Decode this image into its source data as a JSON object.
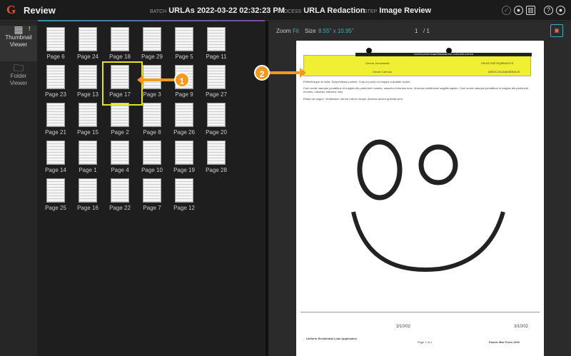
{
  "header": {
    "logo": "G",
    "title": "Review",
    "batch_label": "BATCH",
    "batch": "URLAs 2022-03-22 02:32:23 PM",
    "process_label": "PROCESS",
    "process": "URLA Redaction",
    "step_label": "STEP",
    "step": "Image Review"
  },
  "sidebar": {
    "items": [
      {
        "label": "Thumbnail Viewer",
        "badge": "!"
      },
      {
        "label": "Folder Viewer"
      }
    ]
  },
  "thumbnails": [
    "Page 6",
    "Page 24",
    "Page 18",
    "Page 29",
    "Page 5",
    "Page 11",
    "Page 23",
    "Page 13",
    "Page 17",
    "Page 3",
    "Page 9",
    "Page 27",
    "Page 21",
    "Page 15",
    "Page 2",
    "Page 8",
    "Page 26",
    "Page 20",
    "Page 14",
    "Page 1",
    "Page 4",
    "Page 10",
    "Page 19",
    "Page 28",
    "Page 25",
    "Page 16",
    "Page 22",
    "Page 7",
    "Page 12"
  ],
  "selected": "Page 17",
  "toolbar": {
    "zoom_label": "Zoom",
    "zoom_value": "Fit",
    "size_label": "Size",
    "size_value": "8.55\" x 10.95\"",
    "page": "1",
    "page_total": "/ 1"
  },
  "document": {
    "heading": "CONTINUATION SHEET/RESIDENTIAL LOAN APPLICATION",
    "borrower": "Genna Jonczewski",
    "co_borrower": "Gevan Carrock",
    "agency_case": "P8H4CX8ZT6Q8B4D0Y9",
    "lender_case": "A8R2C24U5A60B3M1J5",
    "para1": "Pellentesque at nulla. Suspendisse potenti. Cras in purus eu magna vulputate luctus.",
    "para2": "Cum sociis natoque penatibus et magnis dis parturient montes, nascetur ridiculus mus. Vivamus vestibulum sagittis sapien. Cum sociis natoque penatibus et magnis dis parturient montes, nascetur ridiculus mus.",
    "para3": "Etiam vel augue. Vestibulum rutrum rutrum neque. Aenean auctor gravida sem.",
    "date1": "3/10/02",
    "date2": "3/10/02",
    "footer_left": "Uniform Residential Loan Application",
    "footer_mid": "Page 1 of 1",
    "footer_right": "Fannie Mae Form 1003"
  },
  "callouts": [
    "1",
    "2"
  ]
}
